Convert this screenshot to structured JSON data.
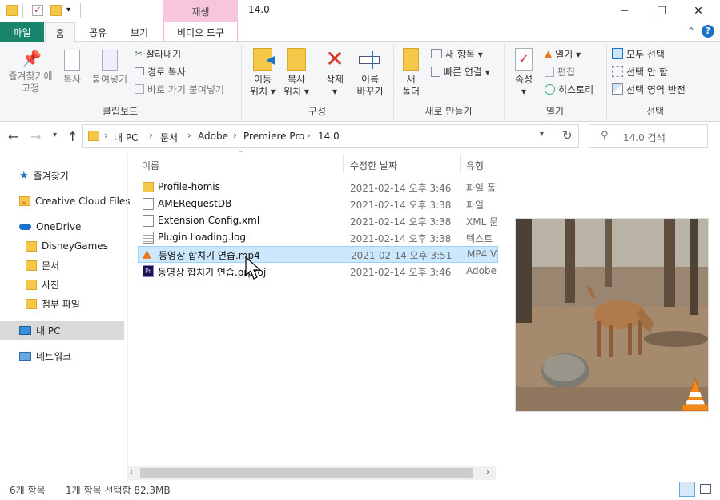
{
  "window": {
    "title": "14.0",
    "context_tab_group": "재생",
    "minimize": "─",
    "maximize": "☐",
    "close": "✕"
  },
  "ribbon": {
    "tabs": [
      "파일",
      "홈",
      "공유",
      "보기",
      "비디오 도구"
    ],
    "clipboard": {
      "pin_label": "즐겨찾기에\n고정",
      "copy_label": "복사",
      "paste_label": "붙여넣기",
      "cut_label": "잘라내기",
      "copy_path_label": "경로 복사",
      "paste_shortcut_label": "바로 가기 붙여넣기",
      "group_label": "클립보드"
    },
    "organize": {
      "move_label": "이동\n위치 ▾",
      "copyto_label": "복사\n위치 ▾",
      "delete_label": "삭제\n▾",
      "rename_label": "이름\n바꾸기",
      "group_label": "구성"
    },
    "new": {
      "new_folder_label": "새\n폴더",
      "new_item_label": "새 항목 ▾",
      "easy_access_label": "빠른 연결 ▾",
      "group_label": "새로 만들기"
    },
    "open": {
      "properties_label": "속성\n▾",
      "open_label": "열기 ▾",
      "edit_label": "편집",
      "history_label": "히스토리",
      "group_label": "열기"
    },
    "select": {
      "select_all_label": "모두 선택",
      "select_none_label": "선택 안 함",
      "invert_label": "선택 영역 반전",
      "group_label": "선택"
    }
  },
  "address": {
    "crumbs": [
      "내 PC",
      "문서",
      "Adobe",
      "Premiere Pro",
      "14.0"
    ],
    "search_placeholder": "14.0 검색"
  },
  "nav": {
    "items": [
      "즐겨찾기",
      "Creative Cloud Files",
      "OneDrive",
      "DisneyGames",
      "문서",
      "사진",
      "첨부 파일",
      "내 PC",
      "네트워크"
    ]
  },
  "files": {
    "headers": [
      "이름",
      "수정한 날짜",
      "유형"
    ],
    "rows": [
      {
        "name": "Profile-homis",
        "date": "2021-02-14 오후 3:46",
        "type": "파일 폴"
      },
      {
        "name": "AMERequestDB",
        "date": "2021-02-14 오후 3:38",
        "type": "파일"
      },
      {
        "name": "Extension Config.xml",
        "date": "2021-02-14 오후 3:38",
        "type": "XML 문"
      },
      {
        "name": "Plugin Loading.log",
        "date": "2021-02-14 오후 3:38",
        "type": "텍스트"
      },
      {
        "name": "동영상 합치기 연습.mp4",
        "date": "2021-02-14 오후 3:51",
        "type": "MP4 V"
      },
      {
        "name": "동영상 합치기 연습.prproj",
        "date": "2021-02-14 오후 3:46",
        "type": "Adobe"
      }
    ]
  },
  "status": {
    "count": "6개 항목",
    "selection": "1개 항목 선택함 82.3MB"
  },
  "colors": {
    "file_tab": "#19866b",
    "context_tab": "#f7c6dc",
    "selection": "#cce8ff",
    "folder": "#f6c84a"
  }
}
